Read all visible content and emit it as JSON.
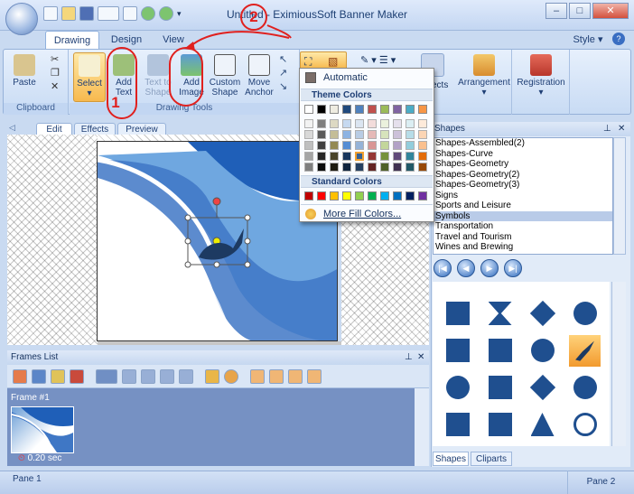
{
  "window": {
    "title": "Untitled - EximiousSoft Banner Maker",
    "style_label": "Style"
  },
  "tabs": [
    "Drawing",
    "Design",
    "View"
  ],
  "ribbon": {
    "clipboard": {
      "paste": "Paste",
      "group": "Clipboard"
    },
    "tools": [
      {
        "l1": "Select",
        "l2": ""
      },
      {
        "l1": "Add",
        "l2": "Text"
      },
      {
        "l1": "Text to",
        "l2": "Shape"
      },
      {
        "l1": "Add",
        "l2": "Image"
      },
      {
        "l1": "Custom",
        "l2": "Shape"
      },
      {
        "l1": "Move",
        "l2": "Anchor"
      }
    ],
    "tools_group": "Drawing Tools",
    "effects": "ects",
    "arrangement": "Arrangement",
    "registration": "Registration"
  },
  "editor_tabs": [
    "Edit",
    "Effects",
    "Preview"
  ],
  "frames": {
    "title": "Frames List",
    "frame_name": "Frame #1",
    "duration": "0.20 sec"
  },
  "shapes": {
    "title": "Shapes",
    "categories": [
      "Shapes-Assembled(2)",
      "Shapes-Curve",
      "Shapes-Geometry",
      "Shapes-Geometry(2)",
      "Shapes-Geometry(3)",
      "Signs",
      "Sports and Leisure",
      "Symbols",
      "Transportation",
      "Travel and Tourism",
      "Wines and Brewing"
    ],
    "selected": "Symbols",
    "tabs": [
      "Shapes",
      "Cliparts"
    ]
  },
  "fill_menu": {
    "automatic": "Automatic",
    "theme_header": "Theme Colors",
    "standard_header": "Standard Colors",
    "more": "More Fill Colors...",
    "theme_top": [
      "#ffffff",
      "#000000",
      "#eeece1",
      "#1f497d",
      "#4f81bd",
      "#c0504d",
      "#9bbb59",
      "#8064a2",
      "#4bacc6",
      "#f79646"
    ],
    "theme_shades": [
      [
        "#f2f2f2",
        "#7f7f7f",
        "#ddd9c3",
        "#c6d9f0",
        "#dbe5f1",
        "#f2dcdb",
        "#ebf1dd",
        "#e5e0ec",
        "#dbeef3",
        "#fdeada"
      ],
      [
        "#d8d8d8",
        "#595959",
        "#c4bd97",
        "#8db3e2",
        "#b8cce4",
        "#e5b9b7",
        "#d7e3bc",
        "#ccc1d9",
        "#b7dde8",
        "#fbd5b5"
      ],
      [
        "#bfbfbf",
        "#3f3f3f",
        "#938953",
        "#548dd4",
        "#95b3d7",
        "#d99694",
        "#c3d69b",
        "#b2a2c7",
        "#92cddc",
        "#fac08f"
      ],
      [
        "#a5a5a5",
        "#262626",
        "#494429",
        "#17365d",
        "#366092",
        "#953734",
        "#76923c",
        "#5f497a",
        "#31859b",
        "#e36c09"
      ],
      [
        "#7f7f7f",
        "#0c0c0c",
        "#1d1b10",
        "#0f243e",
        "#244061",
        "#632423",
        "#4f6128",
        "#3f3151",
        "#205867",
        "#974806"
      ]
    ],
    "standard": [
      "#c00000",
      "#ff0000",
      "#ffc000",
      "#ffff00",
      "#92d050",
      "#00b050",
      "#00b0f0",
      "#0070c0",
      "#002060",
      "#7030a0"
    ]
  },
  "annotations": [
    "1",
    "2"
  ],
  "status": {
    "pane1": "Pane 1",
    "pane2": "Pane 2"
  },
  "colors": {
    "annotation": "#e0201e",
    "selection": "#b9cbe8",
    "frames_bg": "#7691c3"
  }
}
